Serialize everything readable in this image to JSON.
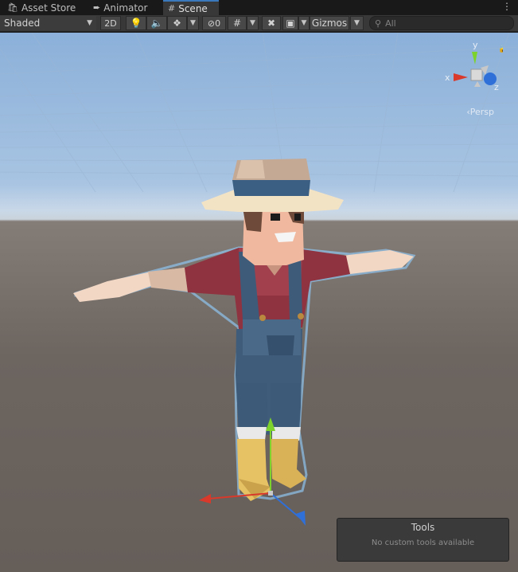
{
  "tabs": [
    {
      "label": "Asset Store",
      "icon": "bag-icon"
    },
    {
      "label": "Animator",
      "icon": "animator-icon"
    },
    {
      "label": "Scene",
      "icon": "scene-grid-icon"
    }
  ],
  "toolbar": {
    "shading_mode": "Shaded",
    "mode_2d": "2D",
    "hidden_count": "0",
    "gizmos_label": "Gizmos",
    "search_placeholder": "All"
  },
  "scene_gizmo": {
    "axis_y": "y",
    "axis_x": "x",
    "axis_z": "z",
    "projection": "Persp"
  },
  "tools_overlay": {
    "title": "Tools",
    "subtitle": "No custom tools available"
  },
  "colors": {
    "accent": "#3a79bb",
    "axis_x": "#d8392b",
    "axis_y": "#7dd22c",
    "axis_z": "#2f6fd8"
  }
}
